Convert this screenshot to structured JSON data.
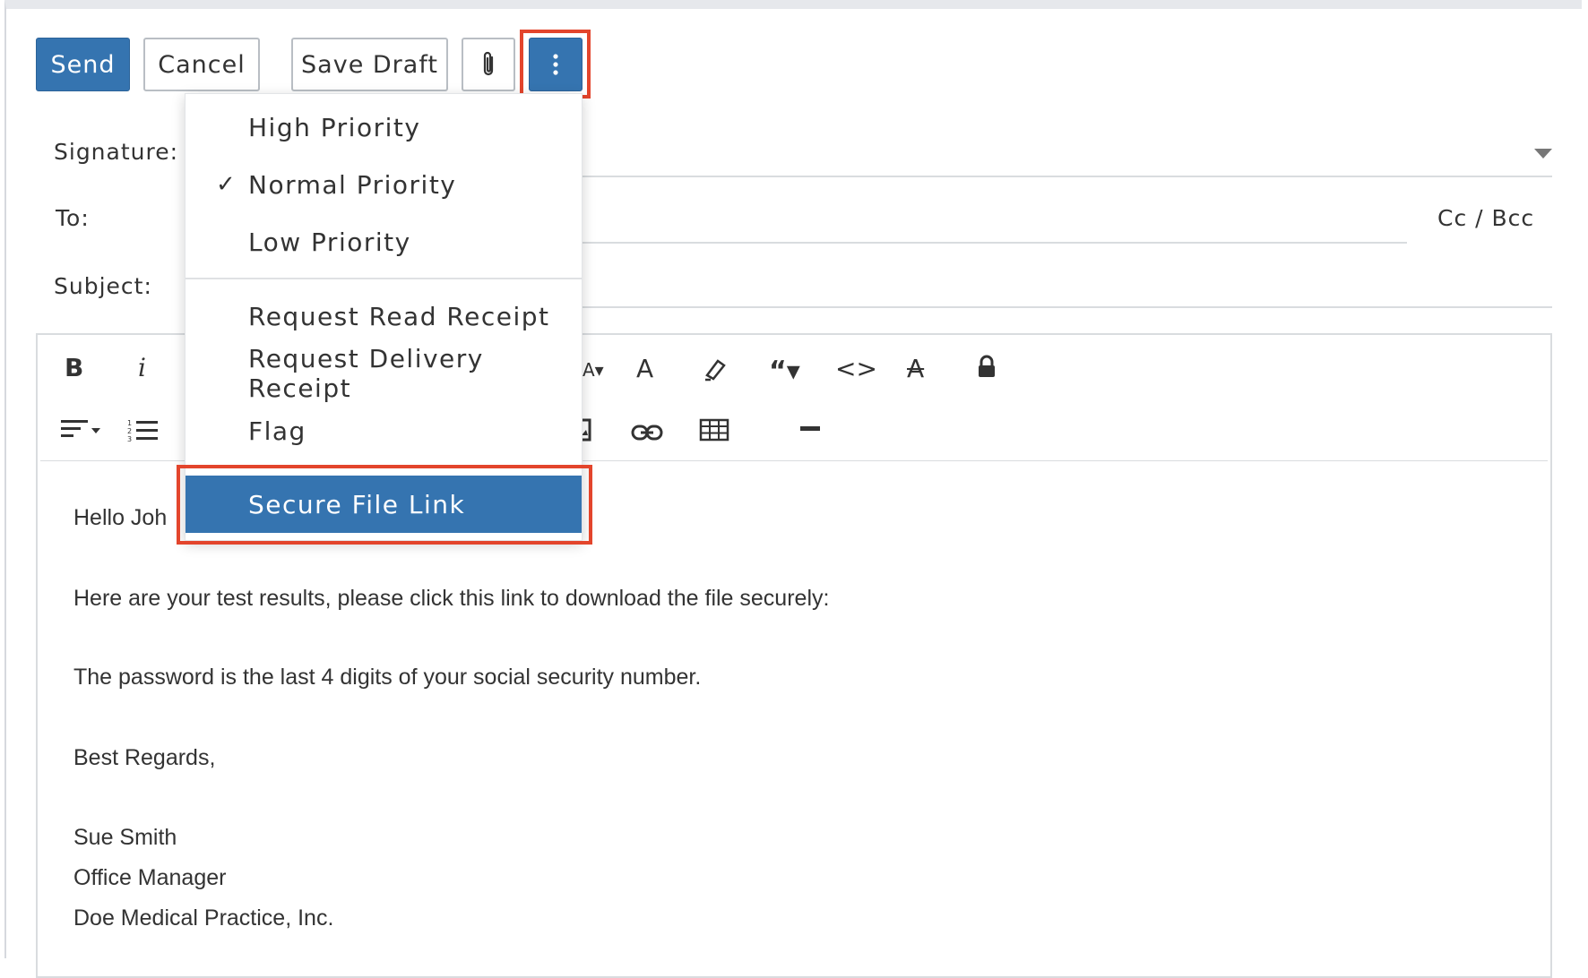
{
  "toolbar": {
    "send_label": "Send",
    "cancel_label": "Cancel",
    "save_draft_label": "Save Draft"
  },
  "fields": {
    "signature_label": "Signature:",
    "to_label": "To:",
    "subject_label": "Subject:",
    "cc_bcc_label": "Cc / Bcc"
  },
  "menu": {
    "priority": [
      "High Priority",
      "Normal Priority",
      "Low Priority"
    ],
    "checked": "Normal Priority",
    "options": [
      "Request Read Receipt",
      "Request Delivery Receipt",
      "Flag"
    ],
    "selected": "Secure File Link"
  },
  "editor": {
    "icons": [
      "bold-icon",
      "italic-icon",
      "font-size-icon",
      "font-color-icon",
      "highlight-icon",
      "quote-icon",
      "code-icon",
      "clear-format-icon",
      "lock-icon",
      "align-icon",
      "ordered-list-icon",
      "image-icon",
      "link-icon",
      "table-icon",
      "horizontal-rule-icon"
    ],
    "body": {
      "greeting": "Hello Joh",
      "line1": "Here are your test results, please click this link to download the file securely:",
      "line2": "The password is the last 4 digits of your social security number.",
      "closing": "Best Regards,",
      "name": "Sue Smith",
      "title": "Office Manager",
      "company": "Doe Medical Practice, Inc."
    }
  },
  "colors": {
    "primary": "#3574b0",
    "highlight_border": "#e3452c"
  }
}
